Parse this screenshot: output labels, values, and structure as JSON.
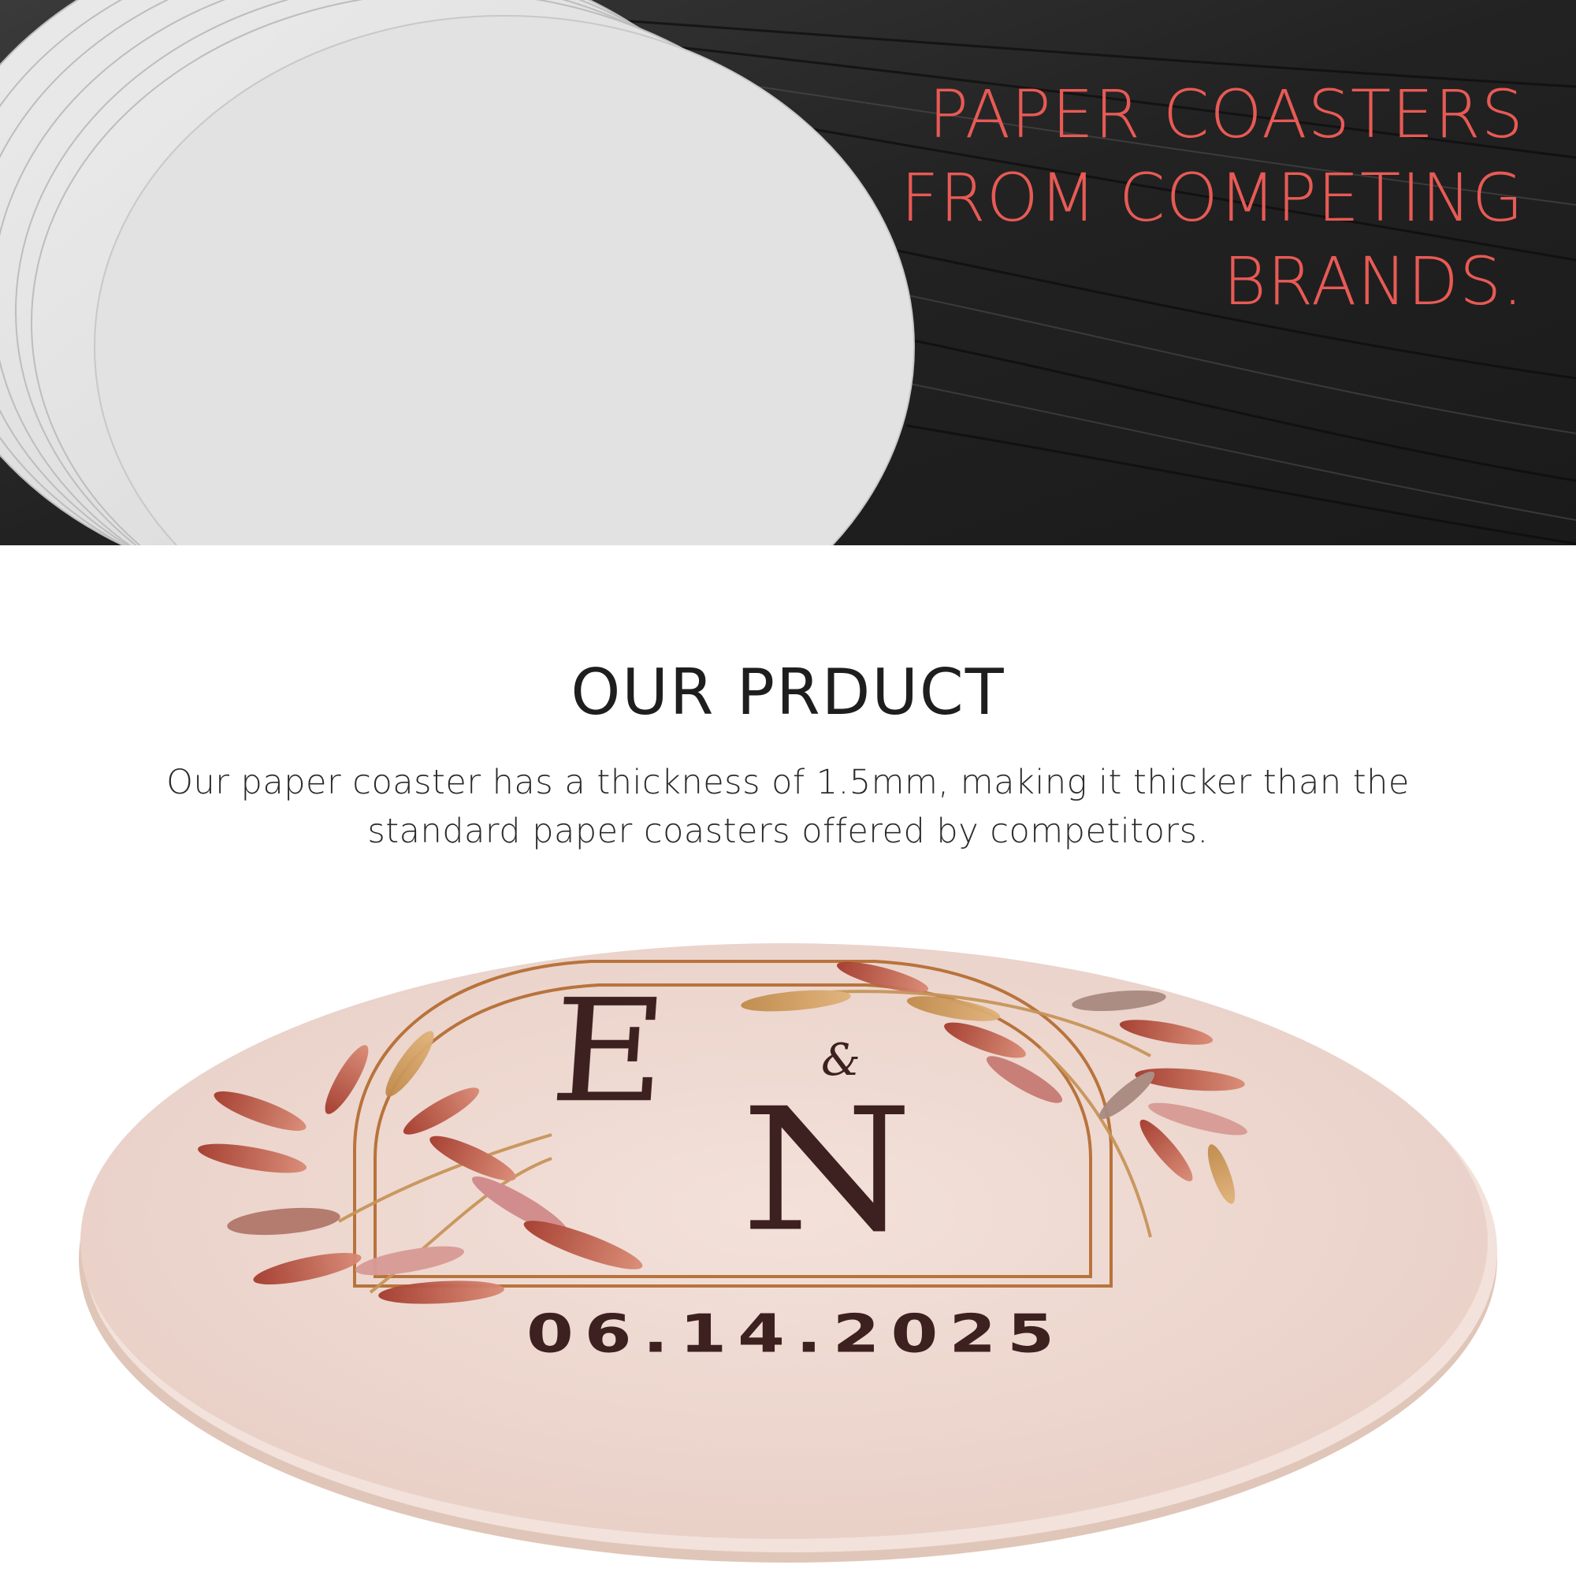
{
  "hero": {
    "title_lines": [
      "PAPER COASTERS",
      "FROM COMPETING",
      "BRANDS."
    ],
    "image": "stack-of-blank-white-paper-coasters-on-dark-wood",
    "accent_color": "#e85a55"
  },
  "product": {
    "heading": "OUR PRDUCT",
    "description": "Our paper coaster has a thickness of 1.5mm, making it thicker than the standard paper coasters offered by competitors."
  },
  "coaster": {
    "monogram_left": "E",
    "monogram_amp": "&",
    "monogram_right": "N",
    "date": "06.14.2025",
    "surface_color": "#efd9d2",
    "ink_color": "#3d2020",
    "frame_color": "#b8733c"
  }
}
